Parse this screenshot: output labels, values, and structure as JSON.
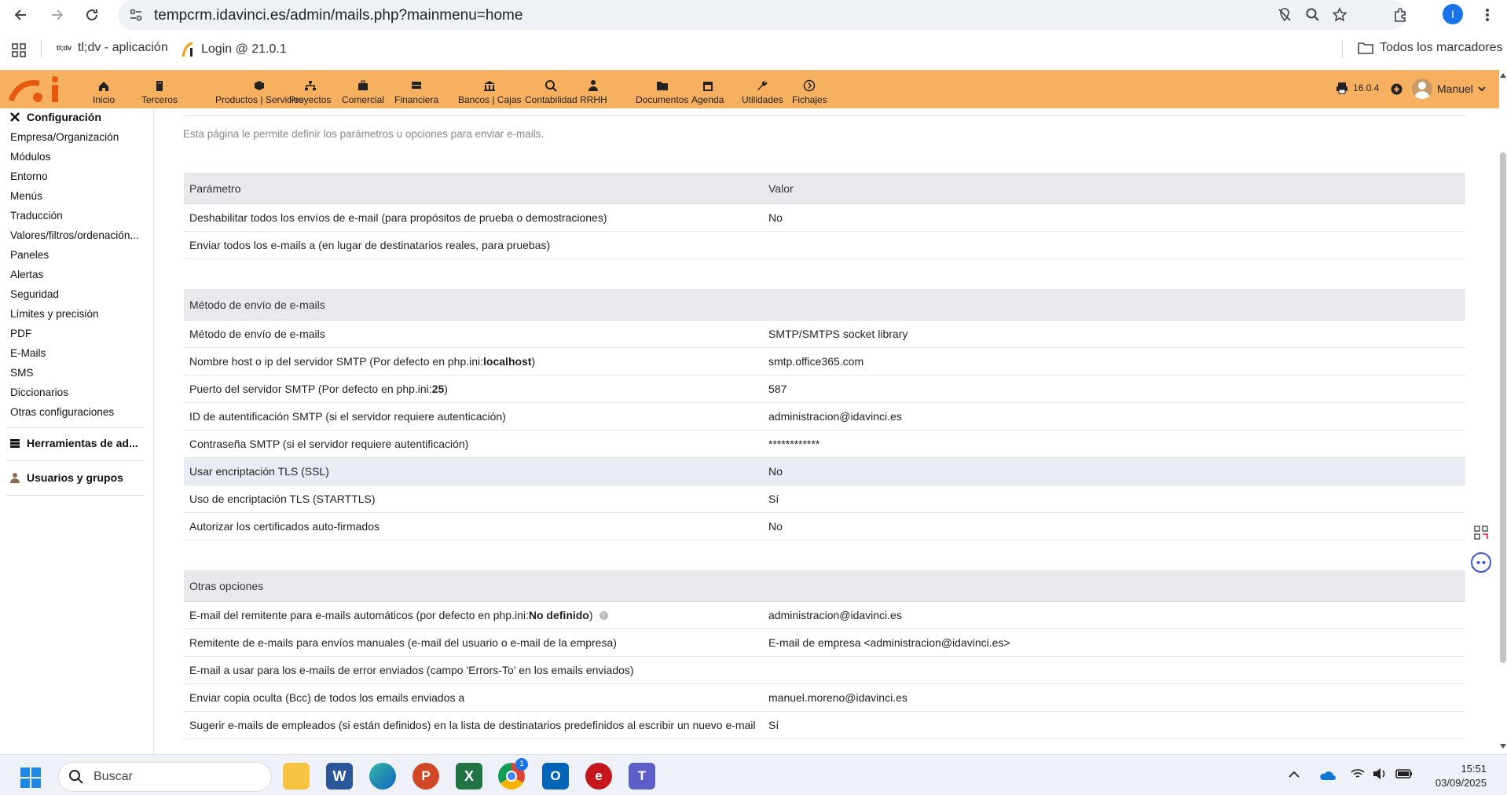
{
  "browser": {
    "url": "tempcrm.idavinci.es/admin/mails.php?mainmenu=home",
    "bookmarks": [
      {
        "label": "tl;dv - aplicación"
      },
      {
        "label": "Login @ 21.0.1"
      }
    ],
    "all_bookmarks": "Todos los marcadores",
    "profile_initial": "I"
  },
  "appbar": {
    "menu": [
      {
        "label": "Inicio",
        "icon": "home-icon"
      },
      {
        "label": "Terceros",
        "icon": "building-icon"
      },
      {
        "label": "Productos | Servicios",
        "icon": "cube-icon"
      },
      {
        "label": "Proyectos",
        "icon": "sitemap-icon"
      },
      {
        "label": "Comercial",
        "icon": "suitcase-icon"
      },
      {
        "label": "Financiera",
        "icon": "money-icon"
      },
      {
        "label": "Bancos | Cajas",
        "icon": "bank-icon"
      },
      {
        "label": "Contabilidad",
        "icon": "search-dollar-icon"
      },
      {
        "label": "RRHH",
        "icon": "user-tie-icon"
      },
      {
        "label": "Documentos",
        "icon": "folder-icon"
      },
      {
        "label": "Agenda",
        "icon": "calendar-icon"
      },
      {
        "label": "Utilidades",
        "icon": "wrench-icon"
      },
      {
        "label": "Fichajes",
        "icon": "clock-icon"
      }
    ],
    "version": "16.0.4",
    "user": "Manuel"
  },
  "sidebar": {
    "title": "Configuración",
    "items": [
      "Empresa/Organización",
      "Módulos",
      "Entorno",
      "Menús",
      "Traducción",
      "Valores/filtros/ordenación...",
      "Paneles",
      "Alertas",
      "Seguridad",
      "Límites y precisión",
      "PDF",
      "E-Mails",
      "SMS",
      "Diccionarios",
      "Otras configuraciones"
    ],
    "tools": "Herramientas de ad...",
    "users": "Usuarios y grupos"
  },
  "main": {
    "intro": "Esta página le permite definir los parámetros u opciones para enviar e-mails.",
    "section1": {
      "col_param": "Parámetro",
      "col_value": "Valor",
      "rows": [
        {
          "param": "Deshabilitar todos los envíos de e-mail (para propósitos de prueba o demostraciones)",
          "value": "No"
        },
        {
          "param": "Enviar todos los e-mails a (en lugar de destinatarios reales, para pruebas)",
          "value": ""
        }
      ]
    },
    "section2": {
      "title": "Método de envío de e-mails",
      "rows": [
        {
          "param": "Método de envío de e-mails",
          "value": "SMTP/SMTPS socket library"
        },
        {
          "param_pre": "Nombre host o ip del servidor SMTP (Por defecto en php.ini: ",
          "param_bold": "localhost",
          "param_post": ")",
          "value": "smtp.office365.com"
        },
        {
          "param_pre": "Puerto del servidor SMTP (Por defecto en php.ini: ",
          "param_bold": "25",
          "param_post": ")",
          "value": "587"
        },
        {
          "param": "ID de autentificación SMTP (si el servidor requiere autenticación)",
          "value": "administracion@idavinci.es"
        },
        {
          "param": "Contraseña SMTP (si el servidor requiere autentificación)",
          "value": "************"
        },
        {
          "param": "Usar encriptación TLS (SSL)",
          "value": "No"
        },
        {
          "param": "Uso de encriptación TLS (STARTTLS)",
          "value": "Sí"
        },
        {
          "param": "Autorizar los certificados auto-firmados",
          "value": "No"
        }
      ]
    },
    "section3": {
      "title": "Otras opciones",
      "rows": [
        {
          "param_pre": "E-mail del remitente para e-mails automáticos (por defecto en php.ini: ",
          "param_bold": "No definido",
          "param_post": ")",
          "value": "administracion@idavinci.es"
        },
        {
          "param": "Remitente de e-mails para envíos manuales (e-mail del usuario o e-mail de la empresa)",
          "value": "E-mail de empresa <administracion@idavinci.es>"
        },
        {
          "param": "E-mail a usar para los e-mails de error enviados (campo 'Errors-To' en los emails enviados)",
          "value": ""
        },
        {
          "param": "Enviar copia oculta (Bcc) de todos los emails enviados a",
          "value": "manuel.moreno@idavinci.es"
        },
        {
          "param": "Sugerir e-mails de empleados (si están definidos) en la lista de destinatarios predefinidos al escribir un nuevo e-mail",
          "value": "Sí"
        }
      ]
    }
  },
  "taskbar": {
    "search_placeholder": "Buscar",
    "time": "15:51",
    "date": "03/09/2025",
    "chrome_badge": "1"
  }
}
